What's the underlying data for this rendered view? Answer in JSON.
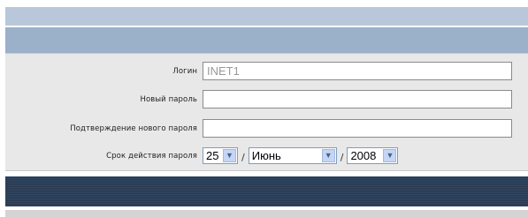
{
  "form": {
    "login": {
      "label": "Логин",
      "value": "INET1"
    },
    "new_password": {
      "label": "Новый пароль",
      "value": ""
    },
    "confirm_password": {
      "label": "Подтверждение нового пароля",
      "value": ""
    },
    "expiry": {
      "label": "Срок действия пароля",
      "day": "25",
      "month": "Июнь",
      "year": "2008",
      "separator": "/"
    }
  },
  "icons": {
    "dropdown_arrow": "chevron-down-icon"
  },
  "colors": {
    "header_light": "#b8c8da",
    "header_blue": "#9bb0c9",
    "form_bg": "#e8e8e8",
    "footer_dark": "#2c3e57"
  }
}
